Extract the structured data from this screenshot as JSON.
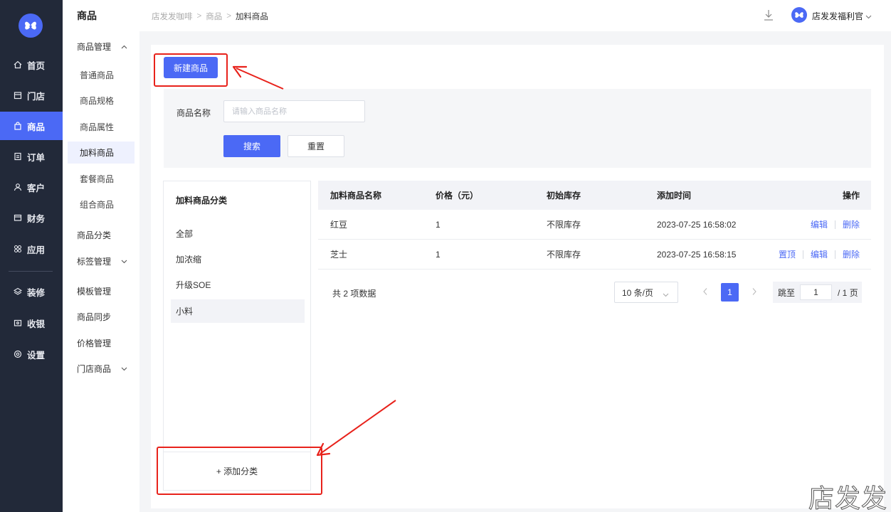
{
  "sidebar": {
    "items": [
      {
        "label": "首页",
        "icon": "home-icon"
      },
      {
        "label": "门店",
        "icon": "store-icon"
      },
      {
        "label": "商品",
        "icon": "bag-icon",
        "active": true
      },
      {
        "label": "订单",
        "icon": "order-icon"
      },
      {
        "label": "客户",
        "icon": "user-icon"
      },
      {
        "label": "财务",
        "icon": "wallet-icon"
      },
      {
        "label": "应用",
        "icon": "grid-icon"
      },
      {
        "label": "装修",
        "icon": "layers-icon"
      },
      {
        "label": "收银",
        "icon": "cashier-icon"
      },
      {
        "label": "设置",
        "icon": "settings-icon"
      }
    ]
  },
  "subnav": {
    "title": "商品",
    "groups": {
      "management": "商品管理",
      "category": "商品分类",
      "tags": "标签管理",
      "template": "模板管理",
      "sync": "商品同步",
      "price": "价格管理",
      "store": "门店商品"
    },
    "items": [
      "普通商品",
      "商品规格",
      "商品属性",
      "加料商品",
      "套餐商品",
      "组合商品"
    ],
    "active_item": "加料商品"
  },
  "topbar": {
    "breadcrumb": [
      "店发发咖啡",
      "商品",
      "加料商品"
    ],
    "user_name": "店发发福利官"
  },
  "toolbar": {
    "new_label": "新建商品"
  },
  "search": {
    "name_label": "商品名称",
    "name_placeholder": "请输入商品名称",
    "search_label": "搜索",
    "reset_label": "重置"
  },
  "categories": {
    "title": "加料商品分类",
    "items": [
      "全部",
      "加浓缩",
      "升级SOE",
      "小料"
    ],
    "active": "小料",
    "add_label": "+ 添加分类"
  },
  "table": {
    "headers": [
      "加料商品名称",
      "价格（元）",
      "初始库存",
      "添加时间",
      "操作"
    ],
    "rows": [
      {
        "name": "红豆",
        "price": "1",
        "stock": "不限库存",
        "time": "2023-07-25 16:58:02",
        "ops": [
          "编辑",
          "删除"
        ]
      },
      {
        "name": "芝士",
        "price": "1",
        "stock": "不限库存",
        "time": "2023-07-25 16:58:15",
        "ops": [
          "置顶",
          "编辑",
          "删除"
        ]
      }
    ]
  },
  "pagination": {
    "total": "共 2 项数据",
    "page_size": "10 条/页",
    "current_page": "1",
    "jump_label": "跳至",
    "jump_value": "1",
    "total_pages": "/ 1 页"
  },
  "watermark": "店发发",
  "colors": {
    "primary": "#4b69f5",
    "sidebar_bg": "#222939",
    "annotation": "#e8221b"
  }
}
